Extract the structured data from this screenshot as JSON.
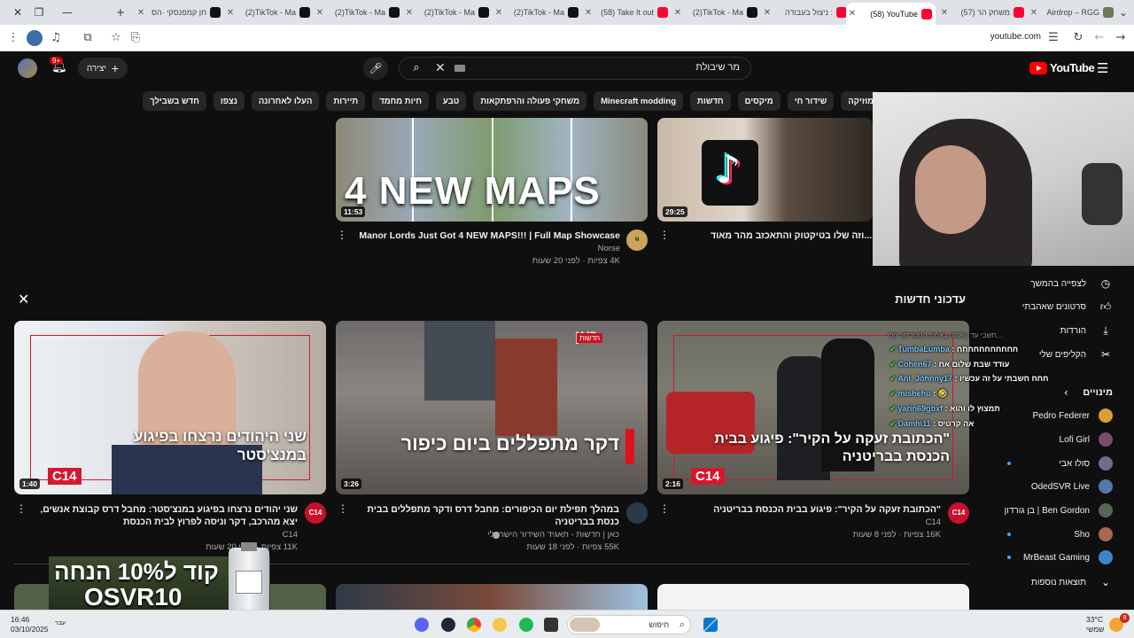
{
  "browser": {
    "tabs": [
      {
        "title": "חן קמפנסקי ·הס",
        "icon": "tiktok-icon",
        "active": false
      },
      {
        "title": "(2)TikTok - Ma",
        "icon": "tiktok-icon",
        "active": false
      },
      {
        "title": "(2)TikTok - Ma",
        "icon": "tiktok-icon",
        "active": false
      },
      {
        "title": "(2)TikTok - Ma",
        "icon": "tiktok-icon",
        "active": false
      },
      {
        "title": "(2)TikTok - Ma",
        "icon": "tiktok-icon",
        "active": false
      },
      {
        "title": "(58) Take It out",
        "icon": "youtube-icon",
        "active": false
      },
      {
        "title": "(2)TikTok - Ma",
        "icon": "tiktok-icon",
        "active": false
      },
      {
        "title": "ניצול בעבודה :",
        "icon": "youtube-icon",
        "active": false
      },
      {
        "title": "(58) YouTube",
        "icon": "youtube-icon",
        "active": true
      },
      {
        "title": "(57) משחק הר",
        "icon": "youtube-icon",
        "active": false
      },
      {
        "title": "Airdrop – RGG",
        "icon": "shield-icon",
        "active": false
      }
    ],
    "url": "youtube.com"
  },
  "header": {
    "notifications_badge": "9+",
    "create_label": "יצירה",
    "search_query": "מר שיבולת",
    "logo_text": "YouTube"
  },
  "chips": [
    "מוזיקה",
    "שידור חי",
    "מיקסים",
    "חדשות",
    "Minecraft modding",
    "משחקי פעולה והרפתקאות",
    "טבע",
    "חיות מחמד",
    "תיירות",
    "העלו לאחרונה",
    "נצפו",
    "חדש בשבילך"
  ],
  "top_videos": [
    {
      "title": "Manor Lords Just Got 4 NEW MAPS!!! | Full Map Showcase",
      "channel": "Norse",
      "meta": "4K צפיות · לפני 20 שעות",
      "duration": "11:53",
      "thumb_text": "4 NEW MAPS"
    },
    {
      "title": "...וזה שלו בטיקטוק והתאכזב מהר מאוד",
      "duration": "29:25"
    }
  ],
  "news": {
    "title": "עדכוני חדשות",
    "items": [
      {
        "title": "שני יהודים נרצחו בפיגוע במנצ'סטר: מחבל דרס קבוצת אנשים, יצא מהרכב, דקר וניסה לפרוץ לבית הכנסת",
        "channel": "C14",
        "meta": "11K צפיות · לפני 20 שעות",
        "duration": "1:40",
        "thumb_text": "שני היהודים נרצחו בפיגוע במנצ'סטר",
        "badge": "C14"
      },
      {
        "title": "במהלך תפילת יום הכיפורים: מחבל דרס ודקר מתפללים בבית כנסת בבריטניה",
        "channel": "כאן | חדשות - תאגיד השידור הישראלי",
        "meta": "55K צפיות · לפני 18 שעות",
        "duration": "3:26",
        "thumb_text": "דקר מתפללים ביום כיפור",
        "badge": "כאן",
        "badge_sub": "חדשות"
      },
      {
        "title": "\"הכתובת זעקה על הקיר\": פיגוע בבית הכנסת בבריטניה",
        "channel": "C14",
        "meta": "16K צפיות · לפני 8 שעות",
        "duration": "2:16",
        "thumb_text": "\"הכתובת זעקה על הקיר\": פיגוע בבית הכנסת בבריטניה",
        "badge": "C14"
      }
    ]
  },
  "sidebar": {
    "items": [
      {
        "label": "לצפייה בהמשך",
        "icon": "clock-icon"
      },
      {
        "label": "סרטונים שאהבתי",
        "icon": "thumbs-up-icon"
      },
      {
        "label": "הורדות",
        "icon": "download-icon"
      },
      {
        "label": "הקליפים שלי",
        "icon": "scissors-icon"
      }
    ],
    "subscriptions_title": "מינויים",
    "subscriptions": [
      {
        "name": "Pedro Federer",
        "color": "#d8a033"
      },
      {
        "name": "Lofi Girl",
        "color": "#7a4b6a"
      },
      {
        "name": "סולו אבי",
        "color": "#6a6f8a"
      },
      {
        "name": "OdedSVR Live",
        "color": "#5577aa"
      },
      {
        "name": "Ben Gordon | בן גורדון",
        "color": "#556655"
      },
      {
        "name": "Sho",
        "color": "#aa6655"
      },
      {
        "name": "MrBeast Gaming",
        "color": "#3a88cc"
      }
    ],
    "show_more": "תוצאות נוספות"
  },
  "chat": [
    {
      "user": "TumbaLumba",
      "msg": "חחחחחחחחחחח"
    },
    {
      "user": "Cohen67",
      "msg": "עודד שבת שלום אח"
    },
    {
      "user": "Anl_Johnny17",
      "msg": "חחח חשבתי על זה עכשיו"
    },
    {
      "user": "mishehu",
      "msg": "🤣"
    },
    {
      "user": "yarin69gbxf",
      "msg": "תמצוץ לו והוא"
    },
    {
      "user": "Damhi11",
      "msg": "אה קרטיס"
    }
  ],
  "chat_hidden_line": "תשבי עד שאתה באמת הסטריפר הכי...",
  "promo": {
    "line1": "קוד ל10% הנחה",
    "line2": "OSVR10"
  },
  "taskbar": {
    "time": "16:46",
    "date": "03/10/2025",
    "weather_temp": "33°C",
    "weather_label": "שמשי",
    "search_label": "חיפוש",
    "notif_count": "9",
    "lang": "עבר"
  }
}
